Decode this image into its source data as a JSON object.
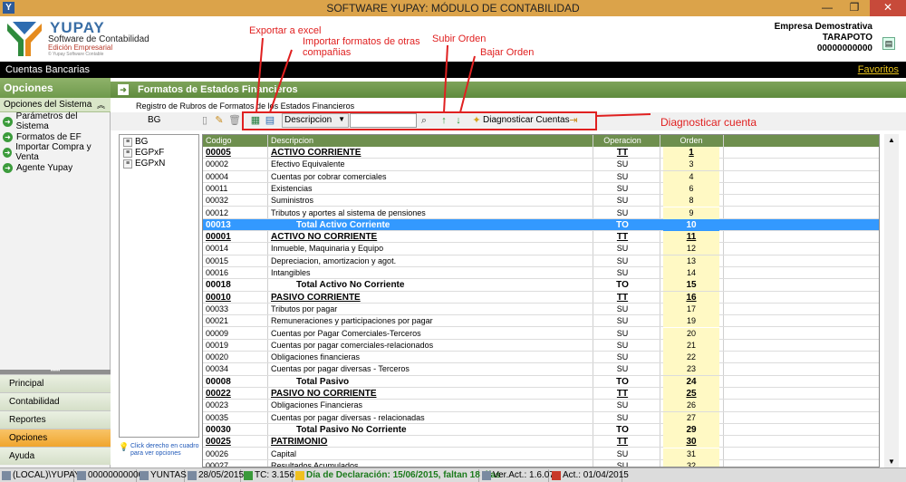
{
  "window": {
    "title": "SOFTWARE YUPAY: MÓDULO DE CONTABILIDAD"
  },
  "header": {
    "logo_name": "YUPAY",
    "logo_subtitle": "Software de Contabilidad",
    "logo_edition": "Edición Empresarial",
    "logo_tagline": "© Yupay Software Contable",
    "company_name": "Empresa Demostrativa",
    "company_city": "TARAPOTO",
    "company_ruc": "00000000000"
  },
  "topbar": {
    "section": "Cuentas Bancarias",
    "favorites": "Favoritos"
  },
  "sidebar": {
    "title": "Opciones",
    "subtitle": "Opciones del Sistema",
    "items": [
      {
        "label": "Parámetros del Sistema"
      },
      {
        "label": "Formatos de EF"
      },
      {
        "label": "Importar Compra y Venta"
      },
      {
        "label": "Agente Yupay"
      }
    ],
    "separator": "•••••",
    "nav": [
      {
        "label": "Principal"
      },
      {
        "label": "Contabilidad"
      },
      {
        "label": "Reportes"
      },
      {
        "label": "Opciones"
      },
      {
        "label": "Ayuda"
      }
    ]
  },
  "main": {
    "title": "Formatos de Estados Financieros",
    "breadcrumb": "Registro de Rubros de Formatos de los Estados Financieros",
    "selected_format": "BG",
    "order_by": "Descripcion",
    "search_value": "",
    "diagnose_label": "Diagnosticar Cuentas"
  },
  "tree": {
    "items": [
      "BG",
      "EGPxF",
      "EGPxN"
    ],
    "hint": "Click derecho en cuadro para ver opciones"
  },
  "grid": {
    "columns": [
      "Codigo",
      "Descripcion",
      "Operacion",
      "Orden"
    ],
    "rows": [
      {
        "code": "00005",
        "desc": "ACTIVO CORRIENTE",
        "op": "TT",
        "order": "1",
        "style": "bu"
      },
      {
        "code": "00002",
        "desc": "Efectivo Equivalente",
        "op": "SU",
        "order": "3",
        "style": ""
      },
      {
        "code": "00004",
        "desc": "Cuentas por cobrar comerciales",
        "op": "SU",
        "order": "4",
        "style": ""
      },
      {
        "code": "00011",
        "desc": "Existencias",
        "op": "SU",
        "order": "6",
        "style": ""
      },
      {
        "code": "00032",
        "desc": "Suministros",
        "op": "SU",
        "order": "8",
        "style": ""
      },
      {
        "code": "00012",
        "desc": "Tributos y aportes al sistema de pensiones",
        "op": "SU",
        "order": "9",
        "style": ""
      },
      {
        "code": "00013",
        "desc": "Total Activo Corriente",
        "op": "TO",
        "order": "10",
        "style": "b sel"
      },
      {
        "code": "00001",
        "desc": "ACTIVO NO CORRIENTE",
        "op": "TT",
        "order": "11",
        "style": "bu"
      },
      {
        "code": "00014",
        "desc": "Inmueble, Maquinaria y Equipo",
        "op": "SU",
        "order": "12",
        "style": ""
      },
      {
        "code": "00015",
        "desc": "Depreciacion, amortizacion y agot.",
        "op": "SU",
        "order": "13",
        "style": ""
      },
      {
        "code": "00016",
        "desc": "Intangibles",
        "op": "SU",
        "order": "14",
        "style": ""
      },
      {
        "code": "00018",
        "desc": "Total Activo No Corriente",
        "op": "TO",
        "order": "15",
        "style": "b"
      },
      {
        "code": "00010",
        "desc": "PASIVO CORRIENTE",
        "op": "TT",
        "order": "16",
        "style": "bu"
      },
      {
        "code": "00033",
        "desc": "Tributos por pagar",
        "op": "SU",
        "order": "17",
        "style": ""
      },
      {
        "code": "00021",
        "desc": "Remuneraciones y participaciones por pagar",
        "op": "SU",
        "order": "19",
        "style": ""
      },
      {
        "code": "00009",
        "desc": "Cuentas por Pagar Comerciales-Terceros",
        "op": "SU",
        "order": "20",
        "style": ""
      },
      {
        "code": "00019",
        "desc": "Cuentas por pagar comerciales-relacionados",
        "op": "SU",
        "order": "21",
        "style": ""
      },
      {
        "code": "00020",
        "desc": "Obligaciones financieras",
        "op": "SU",
        "order": "22",
        "style": ""
      },
      {
        "code": "00034",
        "desc": "Cuentas por pagar diversas - Terceros",
        "op": "SU",
        "order": "23",
        "style": ""
      },
      {
        "code": "00008",
        "desc": "Total Pasivo",
        "op": "TO",
        "order": "24",
        "style": "b"
      },
      {
        "code": "00022",
        "desc": "PASIVO NO CORRIENTE",
        "op": "TT",
        "order": "25",
        "style": "bu"
      },
      {
        "code": "00023",
        "desc": "Obligaciones Financieras",
        "op": "SU",
        "order": "26",
        "style": ""
      },
      {
        "code": "00035",
        "desc": "Cuentas por pagar diversas - relacionadas",
        "op": "SU",
        "order": "27",
        "style": ""
      },
      {
        "code": "00030",
        "desc": "Total Pasivo No Corriente",
        "op": "TO",
        "order": "29",
        "style": "b"
      },
      {
        "code": "00025",
        "desc": "PATRIMONIO",
        "op": "TT",
        "order": "30",
        "style": "bu"
      },
      {
        "code": "00026",
        "desc": "Capital",
        "op": "SU",
        "order": "31",
        "style": ""
      },
      {
        "code": "00027",
        "desc": "Resultados Acumulados",
        "op": "SU",
        "order": "32",
        "style": ""
      }
    ]
  },
  "annotations": {
    "export": "Exportar a excel",
    "import": "Importar formatos de otras compañias",
    "up": "Subir Orden",
    "down": "Bajar Orden",
    "diagnose": "Diagnosticar cuenta",
    "color": "#e02020"
  },
  "statusbar": {
    "server": "(LOCAL)\\YUPAY",
    "ruc": "00000000000",
    "user": "YUNTAS",
    "date": "28/05/2015",
    "tc": "TC: 3.156",
    "declaration": "Día de Declaración: 15/06/2015, faltan 18 días",
    "version": "Ver.Act.: 1.6.07",
    "act": "Act.: 01/04/2015"
  }
}
